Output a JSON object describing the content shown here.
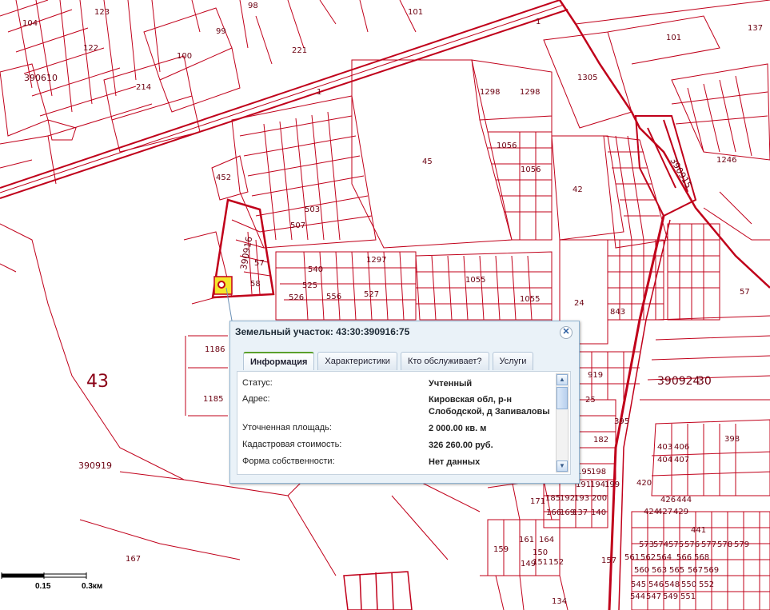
{
  "map": {
    "quarter_labels": [
      "390610",
      "390916",
      "390915",
      "390919",
      "390924",
      "30"
    ],
    "big_label": "43",
    "parcel_labels": [
      "1",
      "1",
      "42",
      "45",
      "24",
      "123",
      "122",
      "104",
      "98",
      "99",
      "100",
      "221",
      "214",
      "101",
      "101",
      "137",
      "1298",
      "1298",
      "1305",
      "1246",
      "1056",
      "1056",
      "452",
      "503",
      "507",
      "540",
      "1297",
      "525",
      "526",
      "556",
      "527",
      "1055",
      "1055",
      "57",
      "58",
      "57",
      "843",
      "1186",
      "1185",
      "167",
      "134",
      "919",
      "25",
      "395",
      "182",
      "403",
      "406",
      "404",
      "407",
      "398",
      "420",
      "424",
      "427",
      "429",
      "426",
      "444",
      "441",
      "573",
      "574",
      "575",
      "576",
      "577",
      "578",
      "579",
      "561",
      "562",
      "564",
      "566",
      "568",
      "560",
      "563",
      "565",
      "567",
      "569",
      "545",
      "546",
      "548",
      "550",
      "552",
      "544",
      "547",
      "549",
      "551",
      "166",
      "169",
      "137",
      "140",
      "185",
      "192",
      "193",
      "200",
      "195",
      "198",
      "191",
      "194",
      "199",
      "159",
      "161",
      "164",
      "151",
      "152",
      "157",
      "171",
      "150",
      "149"
    ],
    "selected_parcel_color": "#f5e62b",
    "line_color": "#c0001a"
  },
  "popup": {
    "title": "Земельный участок: 43:30:390916:75",
    "close_icon": "close-icon",
    "tabs": [
      "Информация",
      "Характеристики",
      "Кто обслуживает?",
      "Услуги"
    ],
    "active_tab": "Информация",
    "fields": [
      {
        "key": "Статус:",
        "value": "Учтенный"
      },
      {
        "key": "Адрес:",
        "value": "Кировская обл, р-н Слободской, д Запиваловы"
      },
      {
        "key": "Уточненная площадь:",
        "value": "2 000.00 кв. м"
      },
      {
        "key": "Кадастровая стоимость:",
        "value": "326 260.00 руб."
      },
      {
        "key": "Форма собственности:",
        "value": "Нет данных"
      }
    ]
  },
  "scale_bar": {
    "labels": [
      "0.15",
      "0.3км"
    ]
  }
}
